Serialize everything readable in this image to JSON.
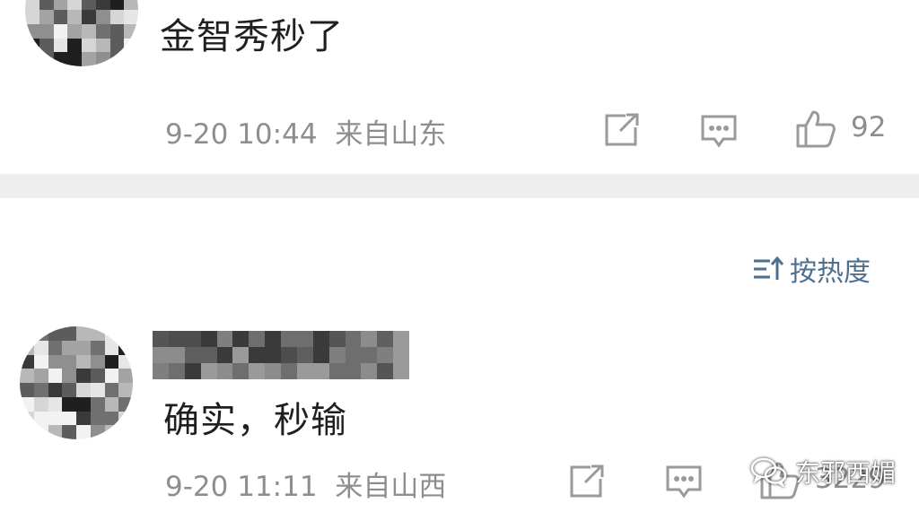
{
  "comments": [
    {
      "text": "金智秀秒了",
      "time": "9-20 10:44",
      "location": "来自山东",
      "likes": "92",
      "icons": {
        "share": "share-icon",
        "reply": "comment-icon",
        "like": "thumbs-up-icon"
      }
    },
    {
      "text": "确实，秒输",
      "time": "9-20 11:11",
      "location": "来自山西",
      "likes": "3229",
      "icons": {
        "share": "share-icon",
        "reply": "comment-icon",
        "like": "thumbs-up-icon"
      }
    }
  ],
  "sort": {
    "label": "按热度",
    "icon": "sort-icon"
  },
  "watermark": {
    "text": "东邪西媚",
    "icon": "wechat-icon"
  },
  "colors": {
    "meta_gray": "#8e8e8e",
    "icon_gray": "#9a9a9a",
    "sort_blue": "#4f6f8f",
    "divider": "#eeeeee"
  }
}
